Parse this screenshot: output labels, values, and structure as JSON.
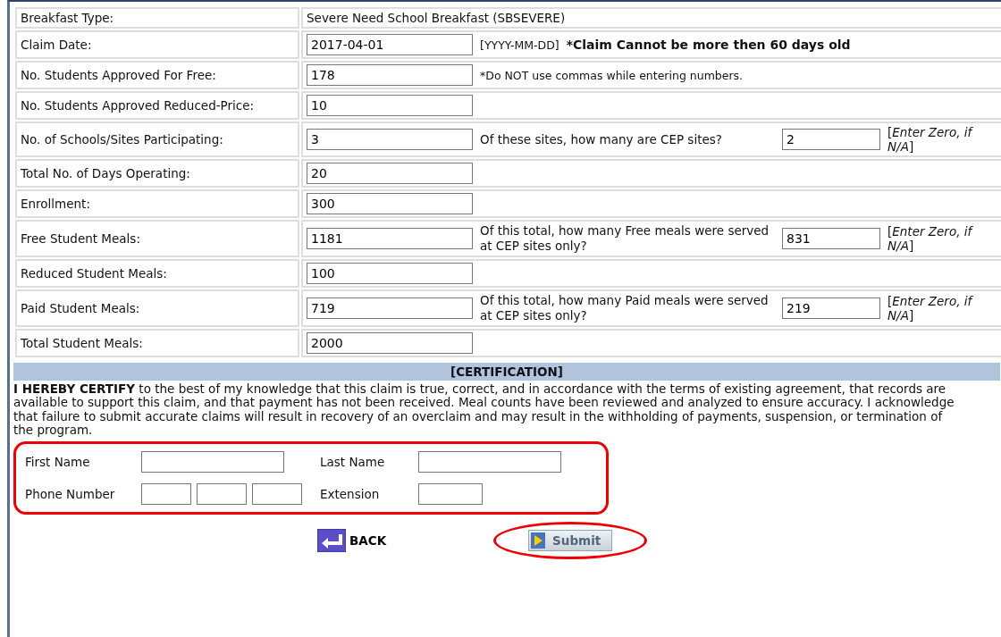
{
  "rows": [
    {
      "label": "Breakfast Type:",
      "kind": "text",
      "value": "Severe Need School Breakfast (SBSEVERE)"
    },
    {
      "label": "Claim Date:",
      "kind": "field",
      "value": "2017-04-01",
      "note": "[YYYY-MM-DD]",
      "warning": "*Claim Cannot be more then 60 days old"
    },
    {
      "label": "No. Students Approved For Free:",
      "kind": "field",
      "value": "178",
      "note": "*Do NOT use commas while entering numbers."
    },
    {
      "label": "No. Students Approved Reduced-Price:",
      "kind": "field",
      "value": "10"
    },
    {
      "label": "No. of Schools/Sites Participating:",
      "kind": "field",
      "value": "3",
      "question": "Of these sites, how many are CEP sites?",
      "sub_value": "2",
      "hint": "[*Enter Zero, if N/A*]"
    },
    {
      "label": "Total No. of Days Operating:",
      "kind": "field",
      "value": "20"
    },
    {
      "label": "Enrollment:",
      "kind": "field",
      "value": "300"
    },
    {
      "label": "Free Student Meals:",
      "kind": "field",
      "value": "1181",
      "question": "Of this total, how many Free meals were served at CEP sites only?",
      "sub_value": "831",
      "hint": "[*Enter Zero, if N/A*]"
    },
    {
      "label": "Reduced Student Meals:",
      "kind": "field",
      "value": "100"
    },
    {
      "label": "Paid Student Meals:",
      "kind": "field",
      "value": "719",
      "question": "Of this total, how many Paid meals were served at CEP sites only?",
      "sub_value": "219",
      "hint": "[*Enter Zero, if N/A*]"
    },
    {
      "label": "Total Student Meals:",
      "kind": "field",
      "value": "2000"
    }
  ],
  "certification": {
    "heading": "[CERTIFICATION]",
    "text": "**I HEREBY CERTIFY** to the best of my knowledge that this claim is true, correct, and in accordance with the terms of existing agreement, that records are available to support this claim, and that payment has not been received. Meal counts have been reviewed and analyzed to ensure accuracy. I acknowledge that failure to submit accurate claims will result in recovery of an overclaim and may result in the withholding of payments, suspension, or termination of the program."
  },
  "signer": {
    "first_name_label": "First Name",
    "last_name_label": "Last Name",
    "phone_label": "Phone Number",
    "extension_label": "Extension"
  },
  "buttons": {
    "back": "BACK",
    "submit": "Submit"
  }
}
